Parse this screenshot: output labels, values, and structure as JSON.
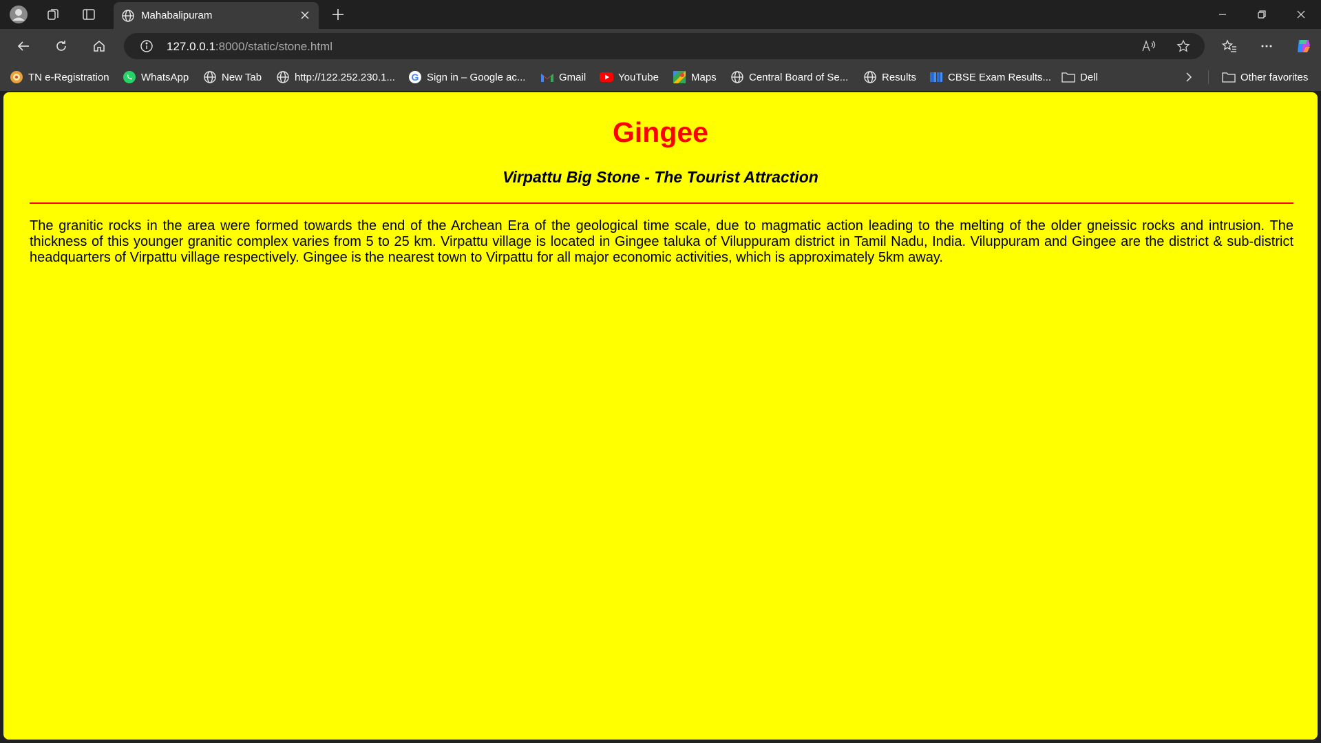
{
  "browser": {
    "tab": {
      "title": "Mahabalipuram"
    },
    "address": {
      "host": "127.0.0.1",
      "rest": ":8000/static/stone.html"
    },
    "bookmarks": [
      {
        "label": "TN e-Registration",
        "icon": "tn-logo-icon"
      },
      {
        "label": "WhatsApp",
        "icon": "whatsapp-icon"
      },
      {
        "label": "New Tab",
        "icon": "globe-icon"
      },
      {
        "label": "http://122.252.230.1...",
        "icon": "globe-icon"
      },
      {
        "label": "Sign in – Google ac...",
        "icon": "google-icon"
      },
      {
        "label": "Gmail",
        "icon": "gmail-icon"
      },
      {
        "label": "YouTube",
        "icon": "youtube-icon"
      },
      {
        "label": "Maps",
        "icon": "maps-icon"
      },
      {
        "label": "Central Board of Se...",
        "icon": "globe-icon"
      },
      {
        "label": "Results",
        "icon": "globe-icon"
      },
      {
        "label": "CBSE Exam Results...",
        "icon": "cbse-icon"
      },
      {
        "label": "Dell",
        "icon": "folder-icon"
      }
    ],
    "other_favorites": "Other favorites"
  },
  "page": {
    "heading": "Gingee",
    "subheading": "Virpattu Big Stone - The Tourist Attraction",
    "paragraph": "The granitic rocks in the area were formed towards the end of the Archean Era of the geological time scale, due to magmatic action leading to the melting of the older gneissic rocks and intrusion. The thickness of this younger granitic complex varies from 5 to 25 km. Virpattu village is located in Gingee taluka of Viluppuram district in Tamil Nadu, India. Viluppuram and Gingee are the district & sub-district headquarters of Virpattu village respectively. Gingee is the nearest town to Virpattu for all major economic activities, which is approximately 5km away."
  },
  "colors": {
    "page_background": "#ffff00",
    "heading": "#ff0000",
    "rule": "#ff0000",
    "chrome_dark": "#202020",
    "chrome_mid": "#3b3b3b"
  }
}
